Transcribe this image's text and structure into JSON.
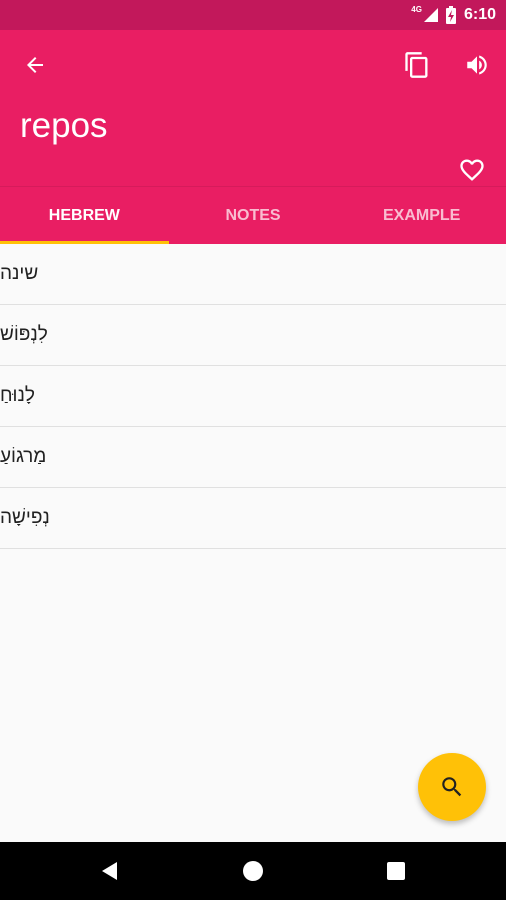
{
  "status_bar": {
    "network": "4G",
    "time": "6:10"
  },
  "header": {
    "word": "repos",
    "accent_color": "#e91e63",
    "icons": [
      "arrow-back-icon",
      "copy-icon",
      "volume-icon",
      "heart-outline-icon"
    ]
  },
  "tabs": [
    {
      "label": "HEBREW",
      "active": true
    },
    {
      "label": "NOTES",
      "active": false
    },
    {
      "label": "EXAMPLE",
      "active": false
    }
  ],
  "translations": [
    "שינה",
    "לִנְפּוֹשׁ",
    "לָנוּחַ",
    "מַרגוֹעַ",
    "נְפִישָׁה"
  ],
  "fab": {
    "icon": "search-icon",
    "color": "#ffc107"
  },
  "nav_bar": {
    "icons": [
      "nav-back-icon",
      "nav-home-icon",
      "nav-recent-icon"
    ]
  }
}
